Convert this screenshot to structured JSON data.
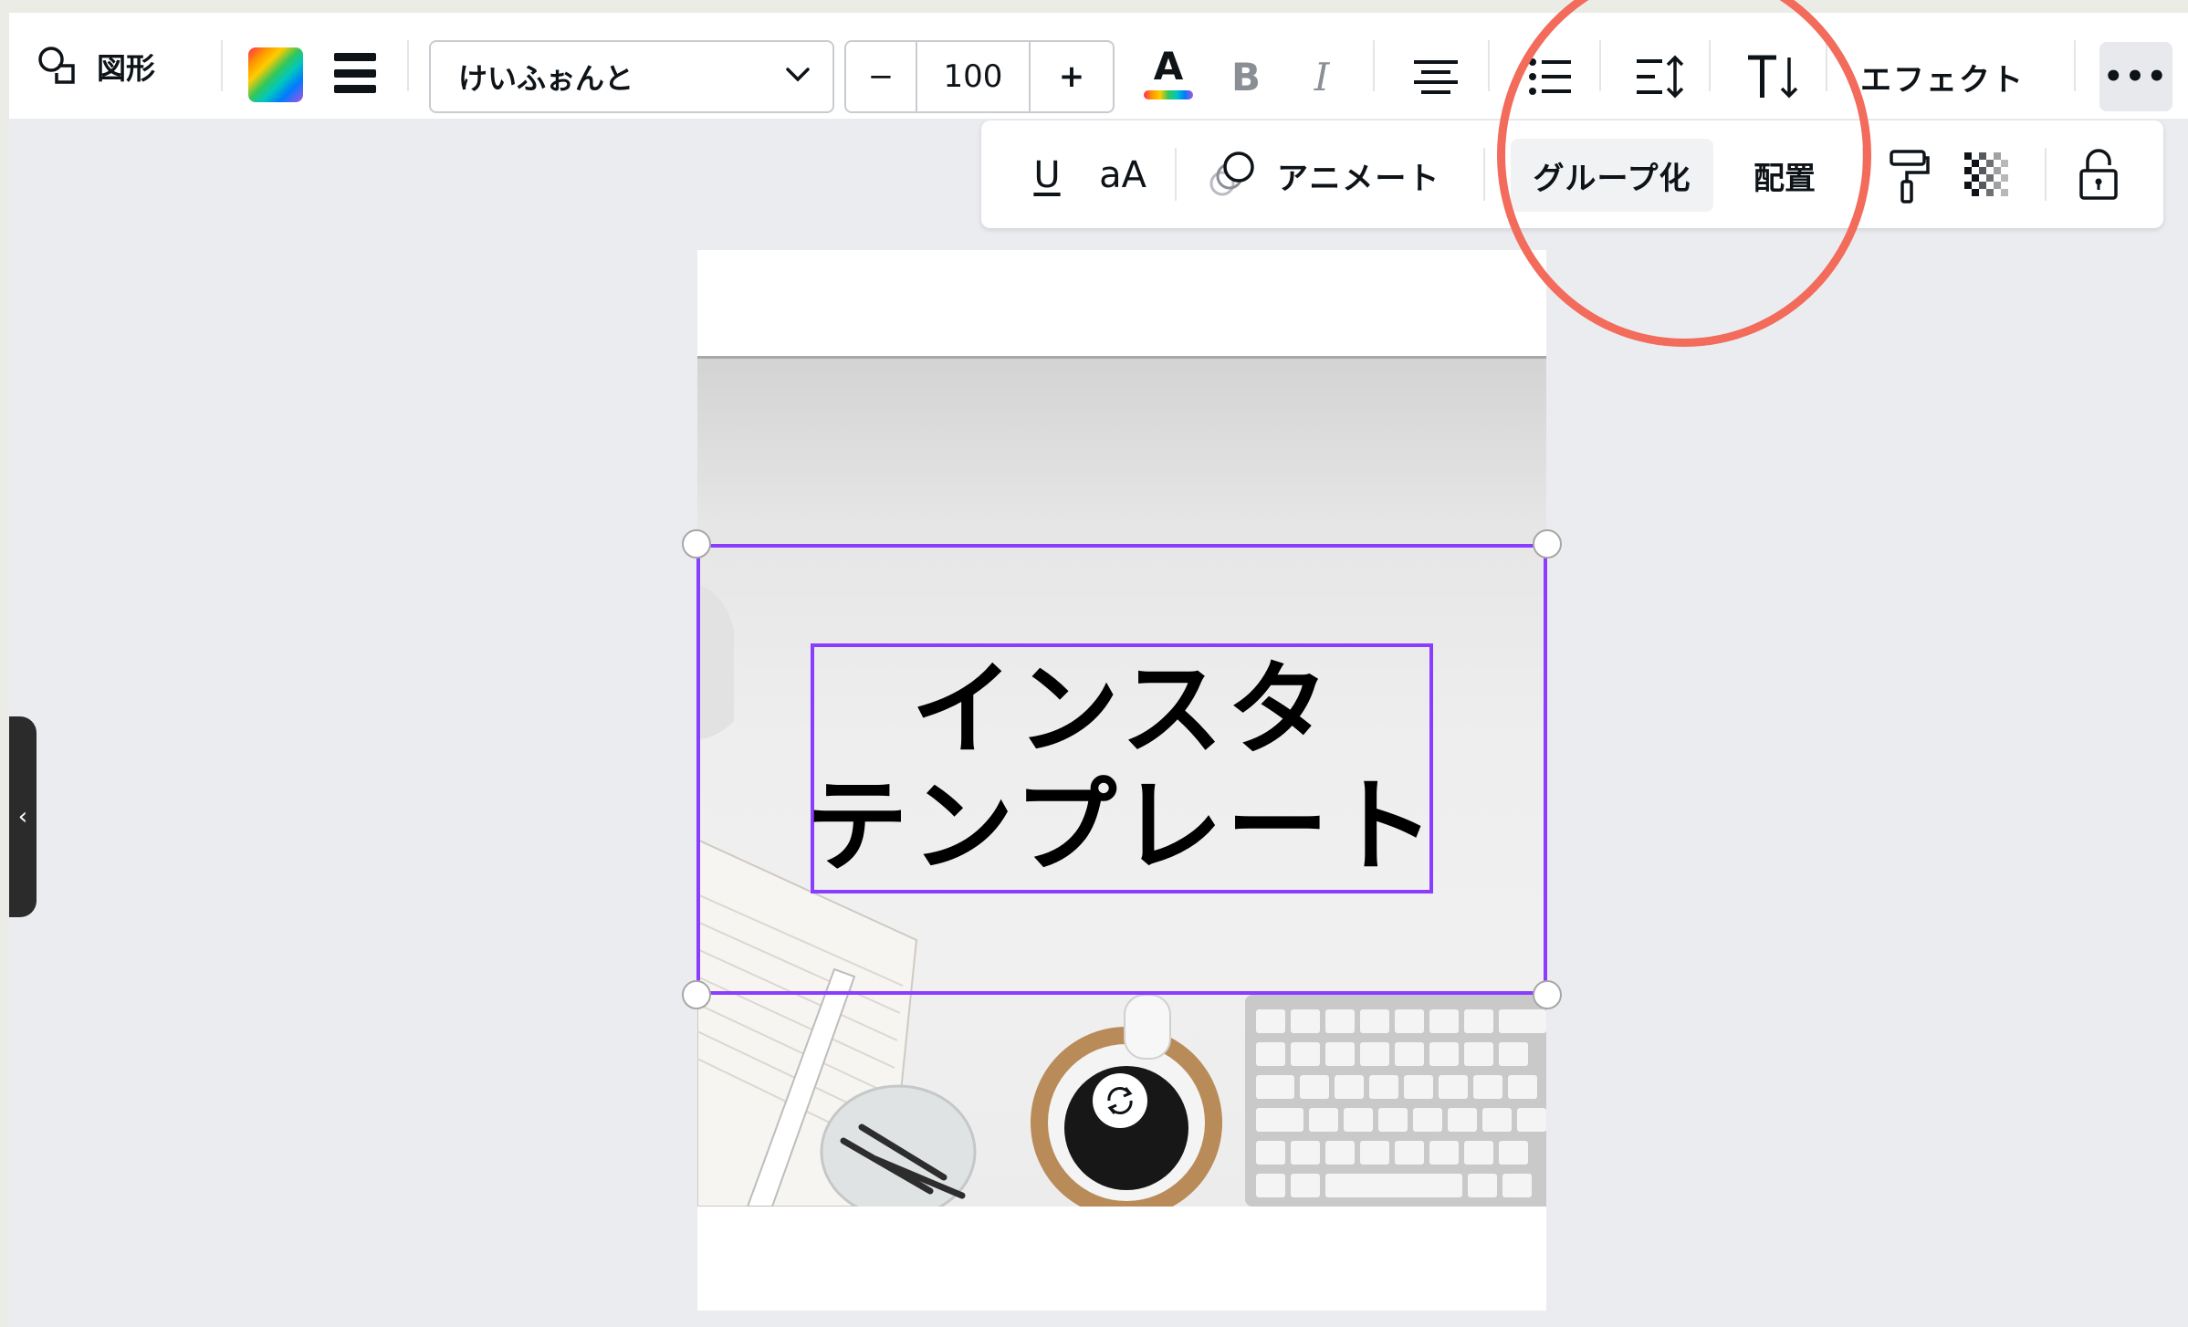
{
  "toolbar": {
    "shape_label": "図形",
    "font_name": "けいふぉんと",
    "font_size": "100",
    "minus": "−",
    "plus": "+",
    "text_color_glyph": "A",
    "bold_glyph": "B",
    "italic_glyph": "I",
    "effect_label": "エフェクト",
    "more_glyph": "•••"
  },
  "toolbar2": {
    "underline_glyph": "U",
    "case_glyph": "aA",
    "animate_label": "アニメート",
    "group_label": "グループ化",
    "position_label": "配置"
  },
  "canvas": {
    "text_lines": [
      "インスタ",
      "テンプレート"
    ]
  },
  "side_panel": {
    "collapse_glyph": "‹"
  },
  "colors": {
    "selection": "#8b3dff",
    "highlight_circle": "#f26b5b"
  },
  "icons": [
    "shape-icon",
    "color-picker-icon",
    "line-weight-icon",
    "chevron-down-icon",
    "align-center-icon",
    "list-icon",
    "line-spacing-icon",
    "vertical-text-icon",
    "animate-icon",
    "paint-roller-icon",
    "transparency-icon",
    "lock-icon",
    "rotate-icon"
  ]
}
